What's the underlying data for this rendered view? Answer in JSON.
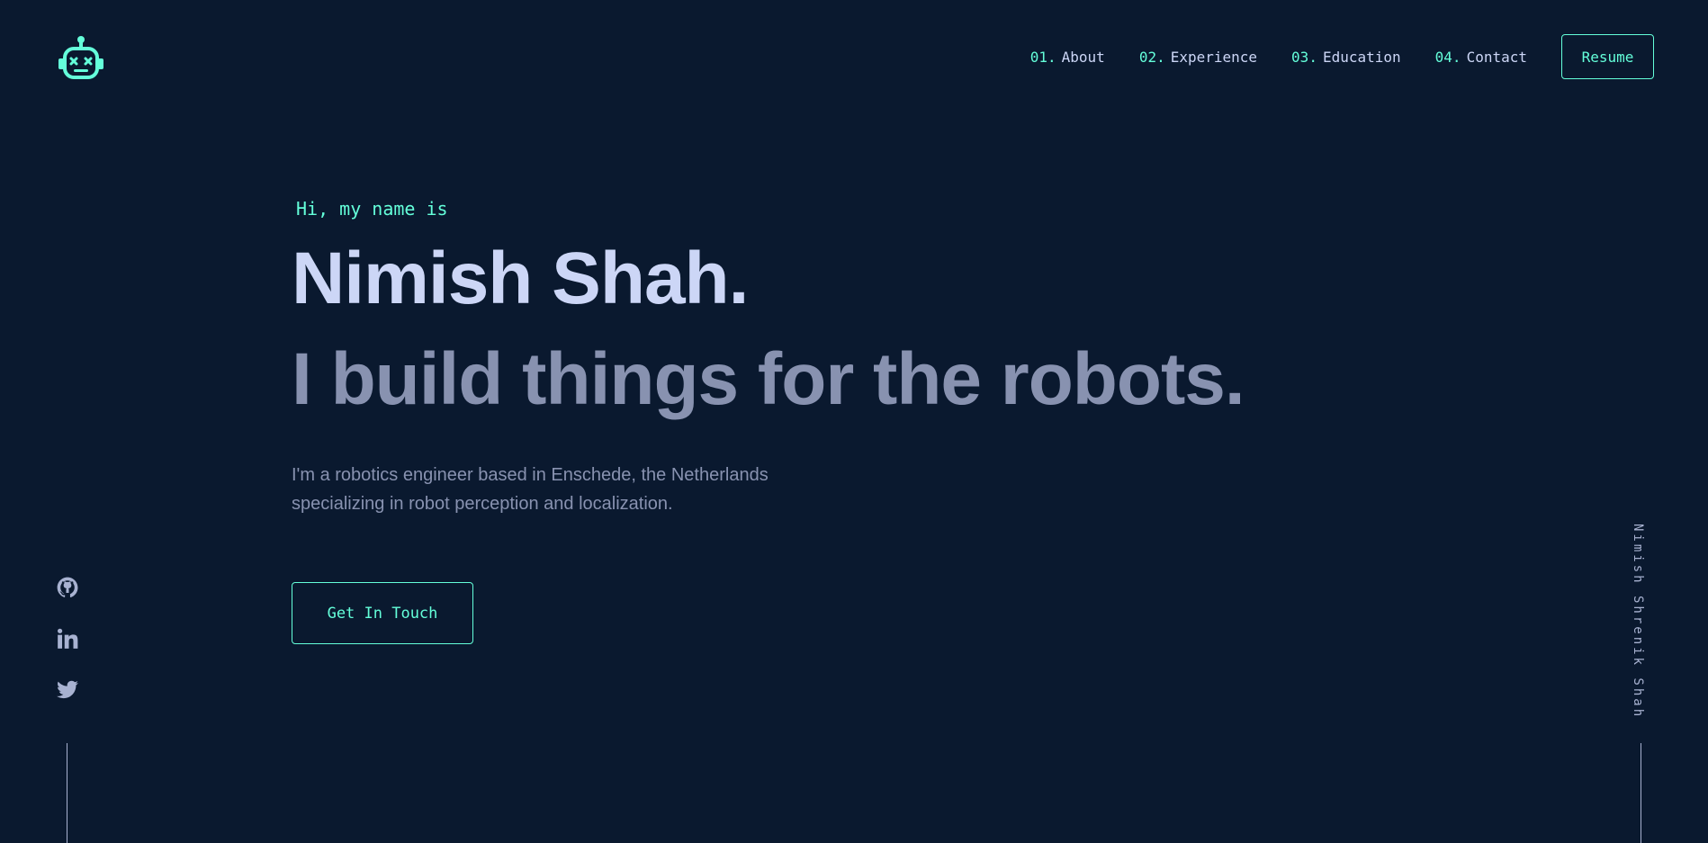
{
  "header": {
    "logo_icon": "robot-icon",
    "nav": [
      {
        "num": "01.",
        "label": "About"
      },
      {
        "num": "02.",
        "label": "Experience"
      },
      {
        "num": "03.",
        "label": "Education"
      },
      {
        "num": "04.",
        "label": "Contact"
      }
    ],
    "resume_label": "Resume"
  },
  "hero": {
    "greeting": "Hi, my name is",
    "name": "Nimish Shah.",
    "tagline": "I build things for the robots.",
    "intro_line1": "I'm a robotics engineer based in Enschede, the Netherlands",
    "intro_line2": "specializing in robot perception and localization.",
    "cta_label": "Get In Touch"
  },
  "social": {
    "icons": [
      "github-icon",
      "linkedin-icon",
      "twitter-icon"
    ]
  },
  "side": {
    "vertical_name": "Nimish Shrenik Shah"
  },
  "colors": {
    "background": "#0a192f",
    "accent": "#64ffda",
    "heading": "#ccd6f6",
    "muted": "#8892b0"
  }
}
